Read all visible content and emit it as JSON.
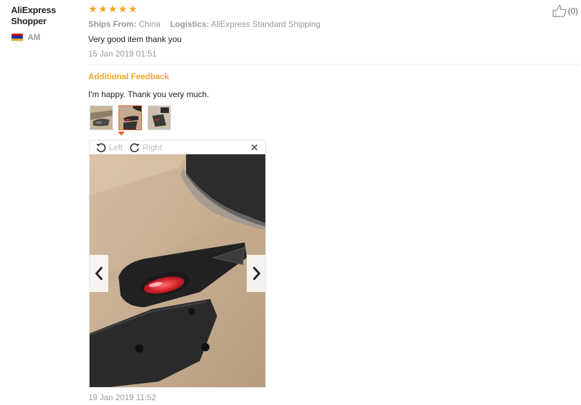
{
  "user": {
    "name": "AliExpress Shopper",
    "country": "AM"
  },
  "review": {
    "rating": 5,
    "ships_from_label": "Ships From:",
    "ships_from": "China",
    "logistics_label": "Logistics:",
    "logistics": "AliExpress Standard Shipping",
    "text": "Very good item thank you",
    "date": "15 Jan 2019 01:51",
    "helpful_count": "(0)"
  },
  "additional": {
    "title": "Additional Feedback",
    "text": "I'm happy. Thank you very much.",
    "selected_thumb": 2,
    "date": "19 Jan 2019 11:52"
  },
  "viewer": {
    "rotate_left": "Left",
    "rotate_right": "Right"
  },
  "icons": {
    "star": "star-icon",
    "helpful": "thumbs-up-icon",
    "rotate_left": "rotate-left-icon",
    "rotate_right": "rotate-right-icon",
    "close": "close-icon",
    "prev": "chevron-left-icon",
    "next": "chevron-right-icon"
  },
  "colors": {
    "accent": "#f5a623",
    "selected_border": "#e0662b",
    "muted": "#999999"
  }
}
